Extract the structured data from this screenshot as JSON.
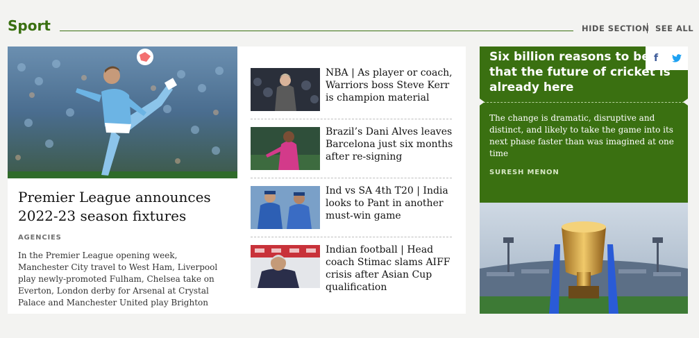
{
  "section": {
    "title": "Sport",
    "hide_label": "HIDE SECTION",
    "see_all_label": "SEE ALL",
    "accent": "#3a7011"
  },
  "lead": {
    "title": "Premier League announces 2022-23 season fixtures",
    "byline": "AGENCIES",
    "standfirst": "In the Premier League opening week, Manchester City travel to West Ham, Liverpool play newly-promoted Fulham, Chelsea take on Everton, London derby for Arsenal at Crystal Palace and Manchester United play Brighton"
  },
  "stories": [
    {
      "title": "NBA | As player or coach, Warriors boss Steve Kerr is champion material"
    },
    {
      "title": "Brazil’s Dani Alves leaves Barcelona just six months after re-signing"
    },
    {
      "title": "Ind vs SA 4th T20 | India looks to Pant in another must-win game"
    },
    {
      "title": "Indian football | Head coach Stimac slams AIFF crisis after Asian Cup qualification"
    }
  ],
  "feature": {
    "title": "Six billion reasons to believe that the future of cricket is already here",
    "standfirst": "The change is dramatic, disruptive and distinct, and likely to take the game into its next phase faster than was imagined at one time",
    "byline": "SURESH MENON"
  },
  "share": {
    "facebook_icon": "f",
    "twitter_icon": "twitter-bird"
  }
}
